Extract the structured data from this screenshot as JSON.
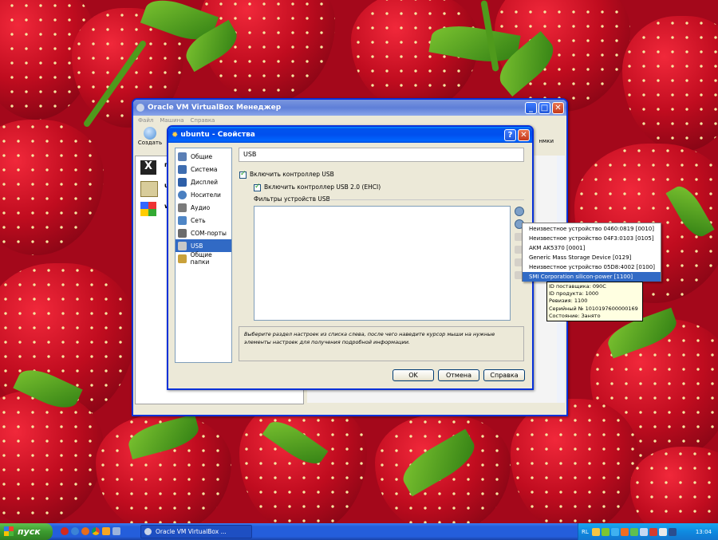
{
  "main_window": {
    "title": "Oracle VM VirtualBox Менеджер",
    "menu": [
      "Файл",
      "Машина",
      "Справка"
    ],
    "create_label": "Создать",
    "right_toolbar_fragment": "нмки",
    "vm_initials": [
      "п",
      "u",
      "w"
    ]
  },
  "dialog": {
    "title": "ubuntu - Свойства",
    "sidebar": [
      {
        "label": "Общие",
        "icon": "general-icon",
        "color": "#5b7fb5"
      },
      {
        "label": "Система",
        "icon": "system-icon",
        "color": "#3e6db0"
      },
      {
        "label": "Дисплей",
        "icon": "display-icon",
        "color": "#2d5fa8"
      },
      {
        "label": "Носители",
        "icon": "storage-icon",
        "color": "#4a7fc0"
      },
      {
        "label": "Аудио",
        "icon": "audio-icon",
        "color": "#7b7b7b"
      },
      {
        "label": "Сеть",
        "icon": "network-icon",
        "color": "#4f86c6"
      },
      {
        "label": "COM-порты",
        "icon": "com-ports-icon",
        "color": "#6b6b6b"
      },
      {
        "label": "USB",
        "icon": "usb-icon",
        "color": "#8a8a8a",
        "selected": true
      },
      {
        "label": "Общие папки",
        "icon": "shared-folders-icon",
        "color": "#c9a13a"
      }
    ],
    "section_title": "USB",
    "enable_usb": "Включить контроллер USB",
    "enable_usb2": "Включить контроллер USB 2.0 (EHCI)",
    "filters_label": "Фильтры устройств USB",
    "hint": "Выберите раздел настроек из списка слева, после чего наведите курсор мыши на нужные элементы настроек для получения подробной информации.",
    "buttons": {
      "ok": "OK",
      "cancel": "Отмена",
      "help": "Справка"
    }
  },
  "usb_device_menu": [
    "Неизвестное устройство 0460:0819 [0010]",
    "Неизвестное устройство 04F3:0103 [0105]",
    "AKM AK5370 [0001]",
    "Generic Mass Storage Device [0129]",
    "Неизвестное устройство 05D8:4002 [0100]",
    "SMI Corporation silicon-power [1100]"
  ],
  "tooltip": [
    "ID поставщика: 090C",
    "ID продукта: 1000",
    "Ревизия: 1100",
    "Серийный № 1010197600000169",
    "Состояние: Занято"
  ],
  "taskbar": {
    "start": "пуск",
    "task": "Oracle VM VirtualBox ...",
    "lang": "RL",
    "clock": "13:04"
  },
  "colors": {
    "taskbar": "#245edb",
    "start_button": "#3c9a2f",
    "selection": "#316ac5",
    "tooltip_bg": "#ffffe1"
  }
}
